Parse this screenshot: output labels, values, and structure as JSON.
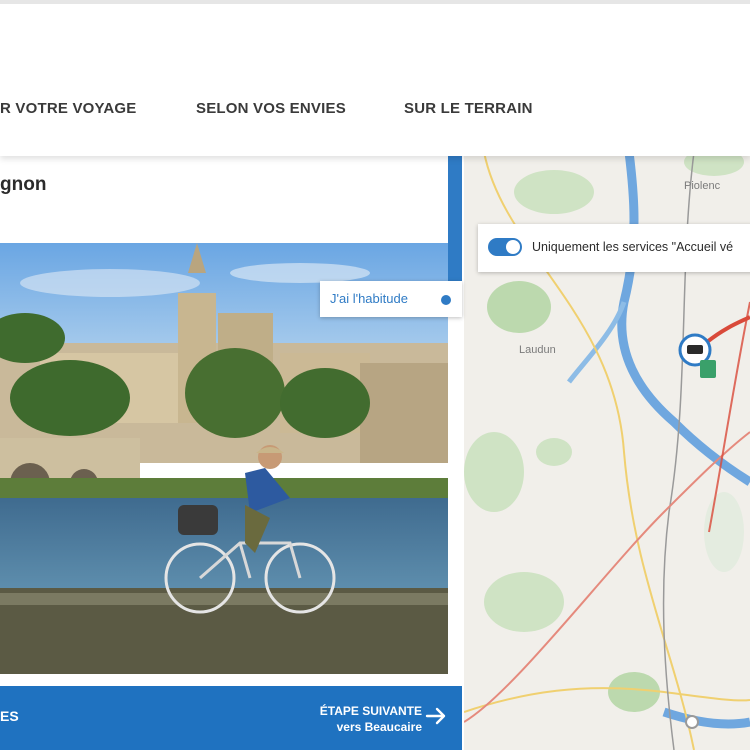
{
  "nav": {
    "items": [
      {
        "label": "R VOTRE VOYAGE"
      },
      {
        "label": "SELON VOS ENVIES"
      },
      {
        "label": "SUR LE TERRAIN"
      }
    ]
  },
  "step": {
    "title": "gnon"
  },
  "photo_badge": {
    "label": "J'ai l'habitude"
  },
  "map": {
    "filter_label": "Uniquement les services \"Accueil vé",
    "filter_enabled": true,
    "places": [
      "Piolenc",
      "Laudun"
    ]
  },
  "footer": {
    "prev_label": "ES",
    "next_line1": "ÉTAPE SUIVANTE",
    "next_line2": "vers Beaucaire"
  },
  "colors": {
    "brand_blue": "#1f72c0",
    "accent_blue": "#2f7bc5",
    "route_red": "#d94a3a"
  }
}
